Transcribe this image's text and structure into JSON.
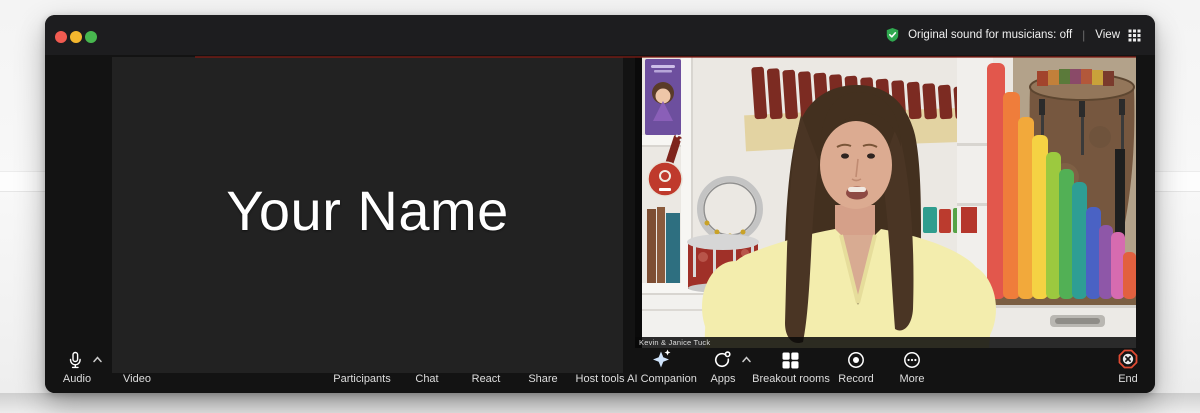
{
  "window": {
    "title_bar": {
      "original_sound": "Original sound for musicians: off",
      "divider": "|",
      "view": "View"
    },
    "traffic_lights": [
      "close",
      "minimize",
      "fullscreen"
    ]
  },
  "participants": {
    "self_tile_name": "Your Name",
    "speaker_tile_name": "Kevin & Janice Tuck"
  },
  "toolbar": {
    "audio": "Audio",
    "video": "Video",
    "participants": "Participants",
    "chat": "Chat",
    "react": "React",
    "share": "Share",
    "host_tools": "Host tools",
    "ai_companion": "AI Companion",
    "apps": "Apps",
    "breakout_rooms": "Breakout rooms",
    "record": "Record",
    "more": "More",
    "end": "End"
  },
  "icons": {
    "topbar": [
      "shield-check-icon",
      "grid-view-icon"
    ],
    "toolbar": [
      "mic-icon",
      "chevron-up-icon",
      "ai-sparkle-icon",
      "apps-ring-icon",
      "breakout-grid-icon",
      "record-icon",
      "more-ellipsis-icon",
      "end-octagon-icon"
    ]
  },
  "colors": {
    "titlebar_bg": "#1d1d1f",
    "tile_bg": "#222222",
    "toolbar_text": "#dedede",
    "end_red": "#e14b33",
    "shield_green": "#2fa84f",
    "ai_sparkle_blue": "#cfe3fb",
    "traffic_red": "#f15b51",
    "traffic_yellow": "#f3b62e",
    "traffic_green": "#48b84f"
  }
}
